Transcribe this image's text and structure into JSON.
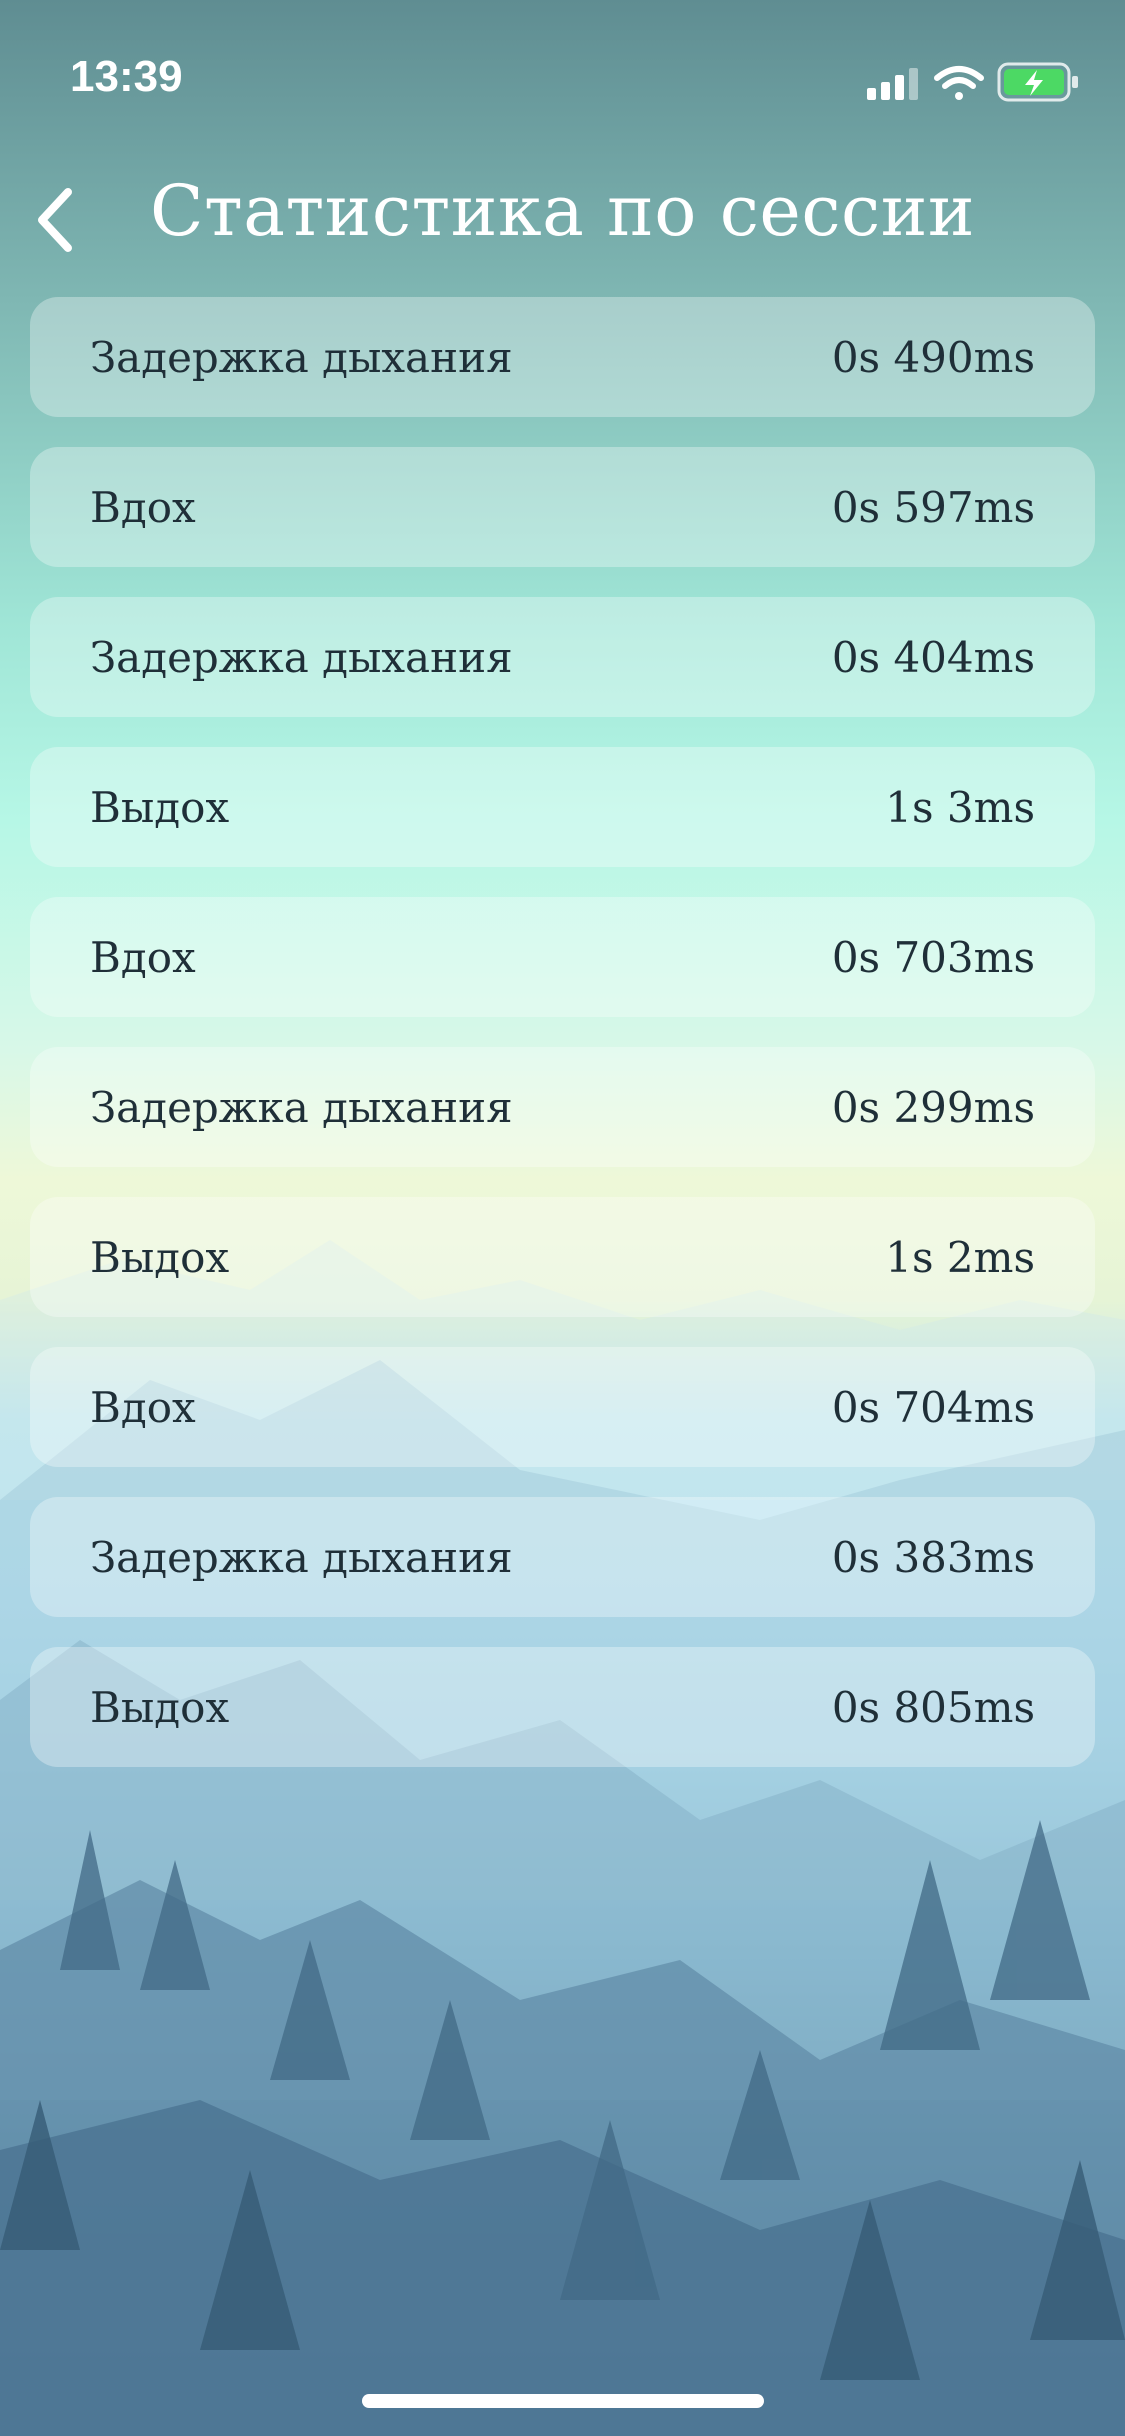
{
  "status": {
    "time": "13:39",
    "icons": [
      "signal-icon",
      "wifi-icon",
      "battery-charging-icon"
    ]
  },
  "header": {
    "title": "Статистика по сессии",
    "back_icon": "chevron-left-icon"
  },
  "rows": [
    {
      "label": "Задержка дыхания",
      "value": "0s 490ms"
    },
    {
      "label": "Вдох",
      "value": "0s 597ms"
    },
    {
      "label": "Задержка дыхания",
      "value": "0s 404ms"
    },
    {
      "label": "Выдох",
      "value": "1s 3ms"
    },
    {
      "label": "Вдох",
      "value": "0s 703ms"
    },
    {
      "label": "Задержка дыхания",
      "value": "0s 299ms"
    },
    {
      "label": "Выдох",
      "value": "1s 2ms"
    },
    {
      "label": "Вдох",
      "value": "0s 704ms"
    },
    {
      "label": "Задержка дыхания",
      "value": "0s 383ms"
    },
    {
      "label": "Выдох",
      "value": "0s 805ms"
    }
  ],
  "colors": {
    "text_dark": "#1f2f38",
    "battery_green": "#4cd964",
    "title": "#ffffff"
  }
}
